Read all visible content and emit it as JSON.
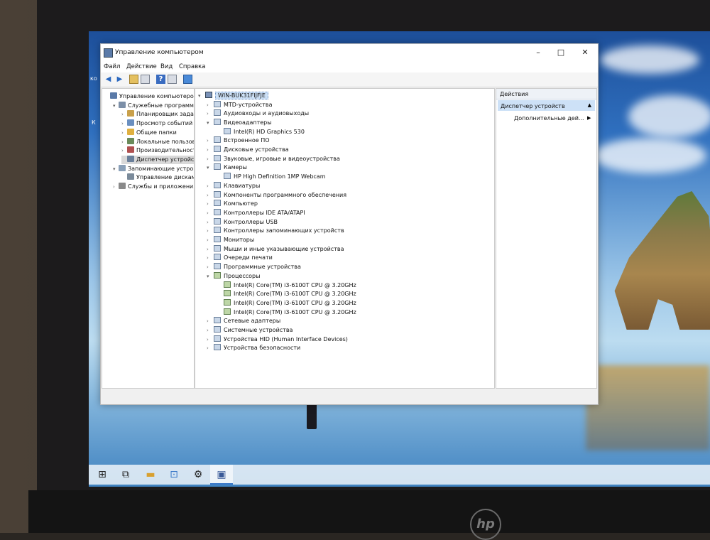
{
  "window": {
    "title": "Управление компьютером",
    "minimize": "–",
    "maximize": "□",
    "close": "✕"
  },
  "menu": [
    "Файл",
    "Действие",
    "Вид",
    "Справка"
  ],
  "toolbar_icons": [
    "back-arrow-icon",
    "forward-arrow-icon",
    "folder-icon",
    "properties-icon",
    "help-icon",
    "panel-icon",
    "monitor-icon"
  ],
  "tree": {
    "items": [
      {
        "label": "Управление компьютером (л",
        "arrow": "",
        "level": 0,
        "color": "#5a7aa8"
      },
      {
        "label": "Служебные программы",
        "arrow": "v",
        "level": 1,
        "color": "#7c8fa8"
      },
      {
        "label": "Планировщик заданий",
        "arrow": ">",
        "level": 2,
        "color": "#c9a04a"
      },
      {
        "label": "Просмотр событий",
        "arrow": ">",
        "level": 2,
        "color": "#6a8fc0"
      },
      {
        "label": "Общие папки",
        "arrow": ">",
        "level": 2,
        "color": "#e0b040"
      },
      {
        "label": "Локальные пользовато",
        "arrow": ">",
        "level": 2,
        "color": "#6a8a5a"
      },
      {
        "label": "Производительность",
        "arrow": ">",
        "level": 2,
        "color": "#b05050"
      },
      {
        "label": "Диспетчер устройств",
        "arrow": "",
        "level": 2,
        "color": "#6a7f9a",
        "selected": true
      },
      {
        "label": "Запоминающие устройст",
        "arrow": "v",
        "level": 1,
        "color": "#8aa0b8"
      },
      {
        "label": "Управление дисками",
        "arrow": "",
        "level": 2,
        "color": "#7a8a9a"
      },
      {
        "label": "Службы и приложения",
        "arrow": ">",
        "level": 1,
        "color": "#8a8a8a"
      }
    ]
  },
  "devices": {
    "root": "WIN-BUK31FIJFJE",
    "rows": [
      {
        "label": "MTD-устройства",
        "arrow": ">",
        "indent": 1
      },
      {
        "label": "Аудиовходы и аудиовыходы",
        "arrow": ">",
        "indent": 1
      },
      {
        "label": "Видеоадаптеры",
        "arrow": "v",
        "indent": 1
      },
      {
        "label": "Intel(R) HD Graphics 530",
        "arrow": "",
        "indent": 2
      },
      {
        "label": "Встроенное ПО",
        "arrow": ">",
        "indent": 1
      },
      {
        "label": "Дисковые устройства",
        "arrow": ">",
        "indent": 1
      },
      {
        "label": "Звуковые, игровые и видеоустройства",
        "arrow": ">",
        "indent": 1
      },
      {
        "label": "Камеры",
        "arrow": "v",
        "indent": 1
      },
      {
        "label": "HP High Definition 1MP Webcam",
        "arrow": "",
        "indent": 2
      },
      {
        "label": "Клавиатуры",
        "arrow": ">",
        "indent": 1
      },
      {
        "label": "Компоненты программного обеспечения",
        "arrow": ">",
        "indent": 1
      },
      {
        "label": "Компьютер",
        "arrow": ">",
        "indent": 1
      },
      {
        "label": "Контроллеры IDE ATA/ATAPI",
        "arrow": ">",
        "indent": 1
      },
      {
        "label": "Контроллеры USB",
        "arrow": ">",
        "indent": 1
      },
      {
        "label": "Контроллеры запоминающих устройств",
        "arrow": ">",
        "indent": 1
      },
      {
        "label": "Мониторы",
        "arrow": ">",
        "indent": 1
      },
      {
        "label": "Мыши и иные указывающие устройства",
        "arrow": ">",
        "indent": 1
      },
      {
        "label": "Очереди печати",
        "arrow": ">",
        "indent": 1
      },
      {
        "label": "Программные устройства",
        "arrow": ">",
        "indent": 1
      },
      {
        "label": "Процессоры",
        "arrow": "v",
        "indent": 1,
        "cpu": true
      },
      {
        "label": "Intel(R) Core(TM) i3-6100T CPU @ 3.20GHz",
        "arrow": "",
        "indent": 2,
        "cpu": true
      },
      {
        "label": "Intel(R) Core(TM) i3-6100T CPU @ 3.20GHz",
        "arrow": "",
        "indent": 2,
        "cpu": true
      },
      {
        "label": "Intel(R) Core(TM) i3-6100T CPU @ 3.20GHz",
        "arrow": "",
        "indent": 2,
        "cpu": true
      },
      {
        "label": "Intel(R) Core(TM) i3-6100T CPU @ 3.20GHz",
        "arrow": "",
        "indent": 2,
        "cpu": true
      },
      {
        "label": "Сетевые адаптеры",
        "arrow": ">",
        "indent": 1
      },
      {
        "label": "Системные устройства",
        "arrow": ">",
        "indent": 1
      },
      {
        "label": "Устройства HID (Human Interface Devices)",
        "arrow": ">",
        "indent": 1
      },
      {
        "label": "Устройства безопасности",
        "arrow": ">",
        "indent": 1
      }
    ]
  },
  "actions": {
    "title": "Действия",
    "section": "Диспетчер устройств",
    "more": "Дополнительные дей...",
    "caret": "▲",
    "more_arrow": "▶"
  },
  "taskbar_icons": [
    "windows-start-icon",
    "task-view-icon",
    "file-explorer-icon",
    "store-icon",
    "settings-gear-icon",
    "computer-management-icon"
  ],
  "desktop_edge_labels": [
    "ко",
    "К"
  ],
  "brand": "hp"
}
